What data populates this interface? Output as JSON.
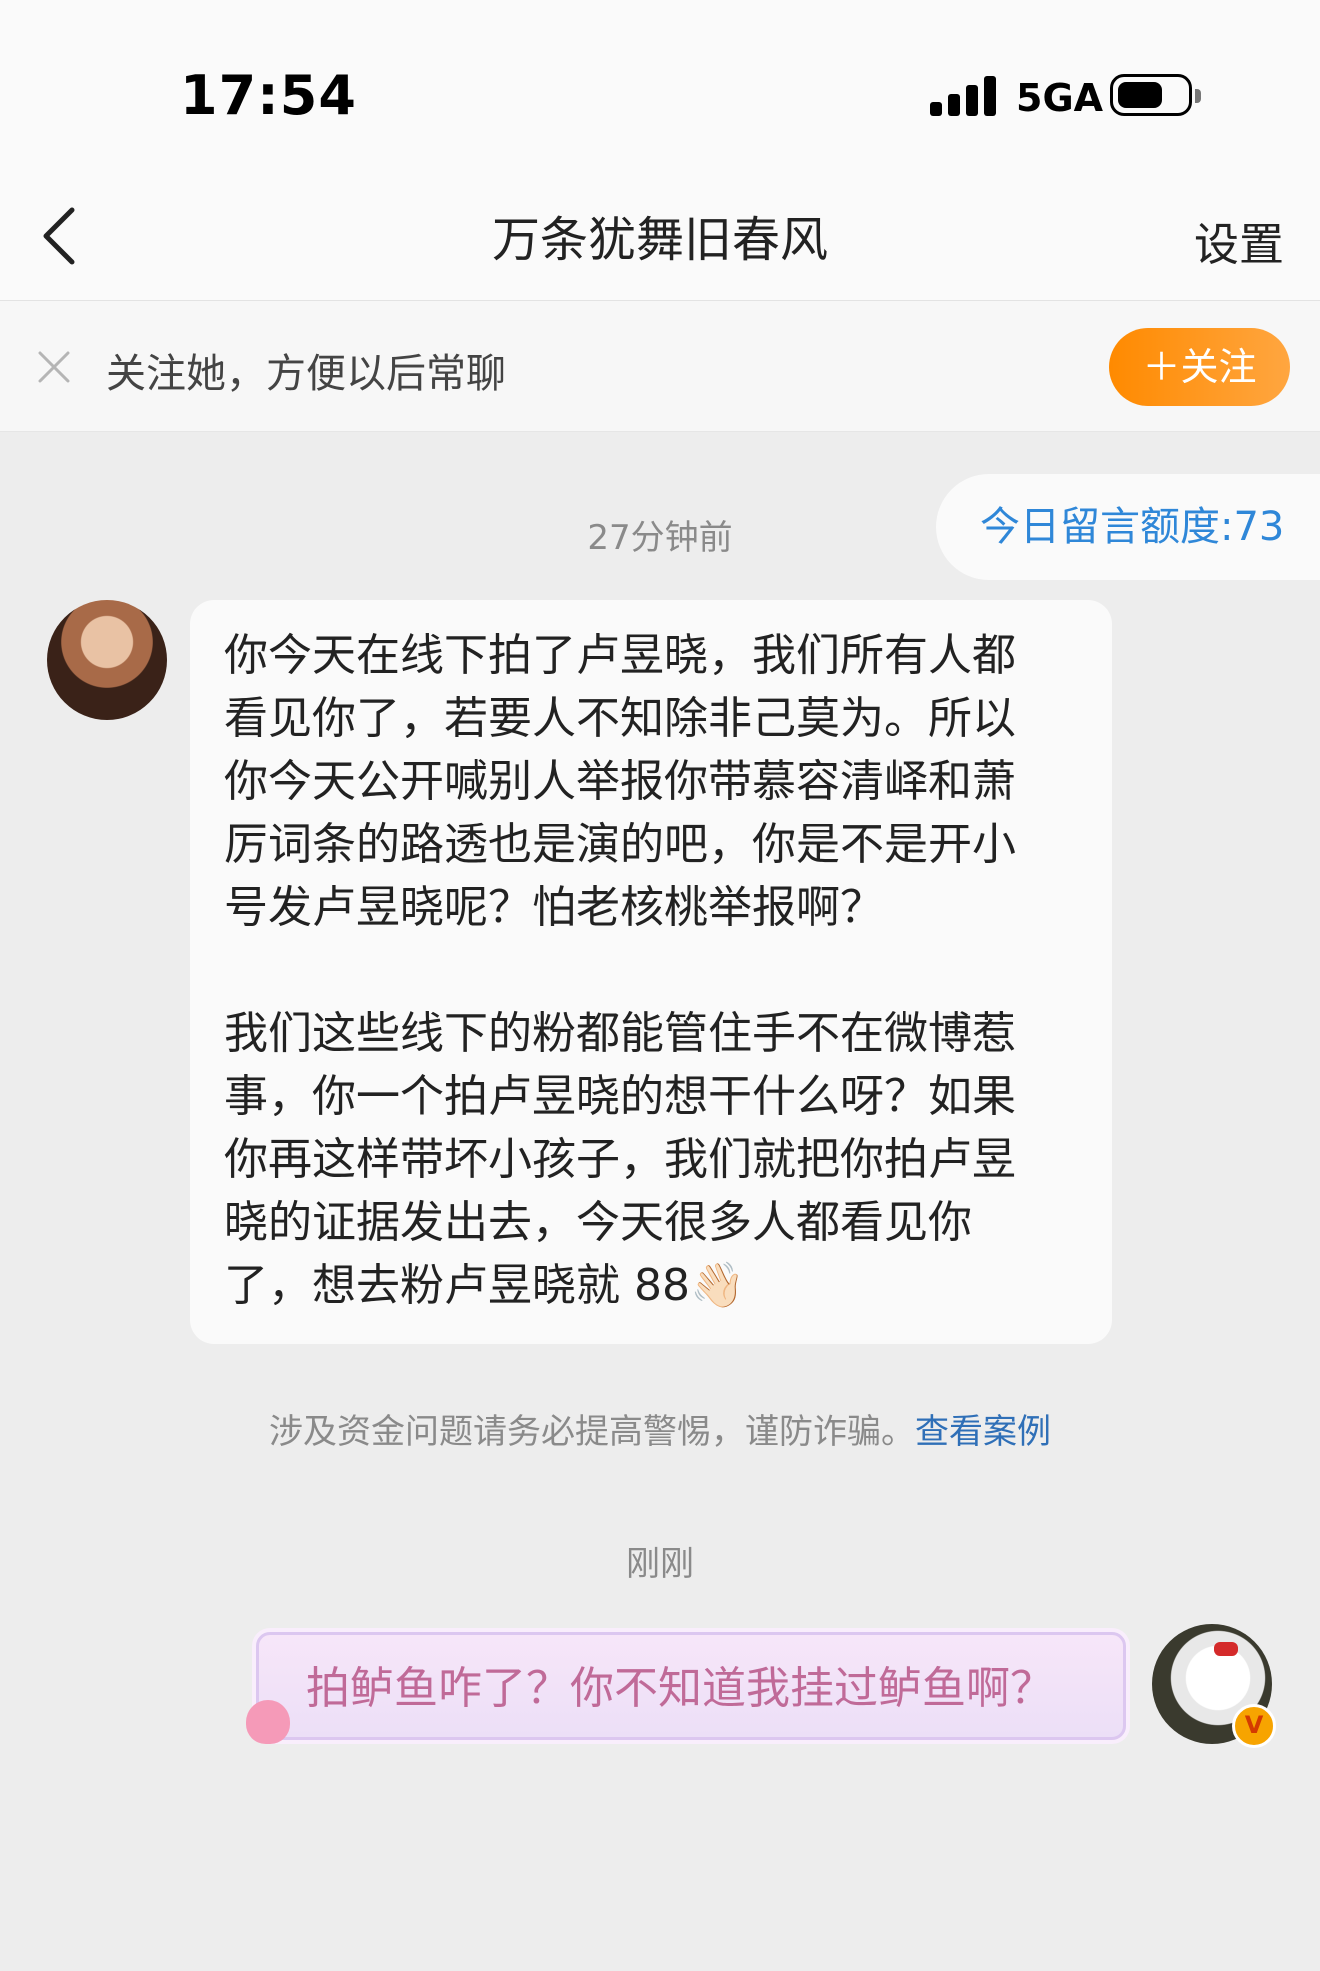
{
  "status_bar": {
    "time": "17:54",
    "network": "5GA",
    "icons": [
      "signal-icon",
      "battery-icon"
    ]
  },
  "nav": {
    "title": "万条犹舞旧春风",
    "settings_label": "设置",
    "back_icon": "chevron-left-icon"
  },
  "follow_bar": {
    "text": "关注她，方便以后常聊",
    "button_label": "＋关注",
    "close_icon": "close-icon",
    "button_color": "#ff9210"
  },
  "quota": {
    "label": "今日留言额度:73"
  },
  "messages": [
    {
      "timestamp": "27分钟前",
      "sender": "other",
      "paragraphs": [
        [
          "你今天在线下拍了卢昱晓，我们所有人都",
          "看见你了，若要人不知除非己莫为。所以",
          "你今天公开喊别人举报你带慕容清峄和萧",
          "厉词条的路透也是演的吧，你是不是开小",
          "号发卢昱晓呢？怕老核桃举报啊？"
        ],
        [
          "我们这些线下的粉都能管住手不在微博惹",
          "事，你一个拍卢昱晓的想干什么呀？如果",
          "你再这样带坏小孩子，我们就把你拍卢昱",
          "晓的证据发出去，今天很多人都看见你",
          "了，想去粉卢昱晓就 88"
        ]
      ],
      "emoji": "👋🏻"
    },
    {
      "timestamp": "刚刚",
      "sender": "me",
      "text": "拍鲈鱼咋了？你不知道我挂过鲈鱼啊？"
    }
  ],
  "warning": {
    "text": "涉及资金问题请务必提高警惕，谨防诈骗。",
    "link": "查看案例"
  },
  "badge": {
    "label": "V"
  },
  "colors": {
    "link": "#2f6fb7",
    "quota": "#2f87d8",
    "sticker_text": "#c06a98"
  }
}
